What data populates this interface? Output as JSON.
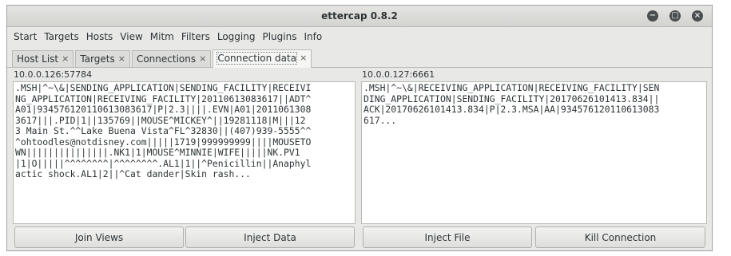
{
  "window": {
    "title": "ettercap 0.8.2",
    "controls": {
      "minimize": "−",
      "maximize": "□",
      "close": "×"
    }
  },
  "menu": [
    "Start",
    "Targets",
    "Hosts",
    "View",
    "Mitm",
    "Filters",
    "Logging",
    "Plugins",
    "Info"
  ],
  "tabs": [
    {
      "label": "Host List",
      "close": "×"
    },
    {
      "label": "Targets",
      "close": "×"
    },
    {
      "label": "Connections",
      "close": "×"
    },
    {
      "label": "Connection data",
      "close": "×",
      "active": true
    }
  ],
  "left_pane": {
    "address": "10.0.0.126:57784",
    "lines": [
      ".MSH|^~\\&|SENDING_APPLICATION|SENDING_FACILITY|RECEIVI",
      "NG_APPLICATION|RECEIVING_FACILITY|20110613083617||ADT^",
      "A01|934576120110613083617|P|2.3||||.EVN|A01|2011061308",
      "3617|||.PID|1||135769||MOUSE^MICKEY^||19281118|M|||12",
      "3 Main St.^^Lake Buena Vista^FL^32830||(407)939-5555^^",
      "^ohtoodles@notdisney.com|||||1719|999999999||||MOUSETO",
      "WN|||||||||||||||.NK1|1|MOUSE^MINNIE|WIFE|||||NK.PV1",
      "|1|O|||||^^^^^^^^|^^^^^^^^.AL1|1||^Penicillin||Anaphyl",
      "actic shock.AL1|2||^Cat dander|Skin rash..."
    ]
  },
  "right_pane": {
    "address": "10.0.0.127:6661",
    "lines": [
      ".MSH|^~\\&|RECEIVING_APPLICATION|RECEIVING_FACILITY|SEN",
      "DING_APPLICATION|SENDING_FACILITY|20170626101413.834||",
      "ACK|20170626101413.834|P|2.3.MSA|AA|934576120110613083",
      "617..."
    ]
  },
  "buttons": {
    "join_views": "Join Views",
    "inject_data": "Inject Data",
    "inject_file": "Inject File",
    "kill_connection": "Kill Connection"
  }
}
